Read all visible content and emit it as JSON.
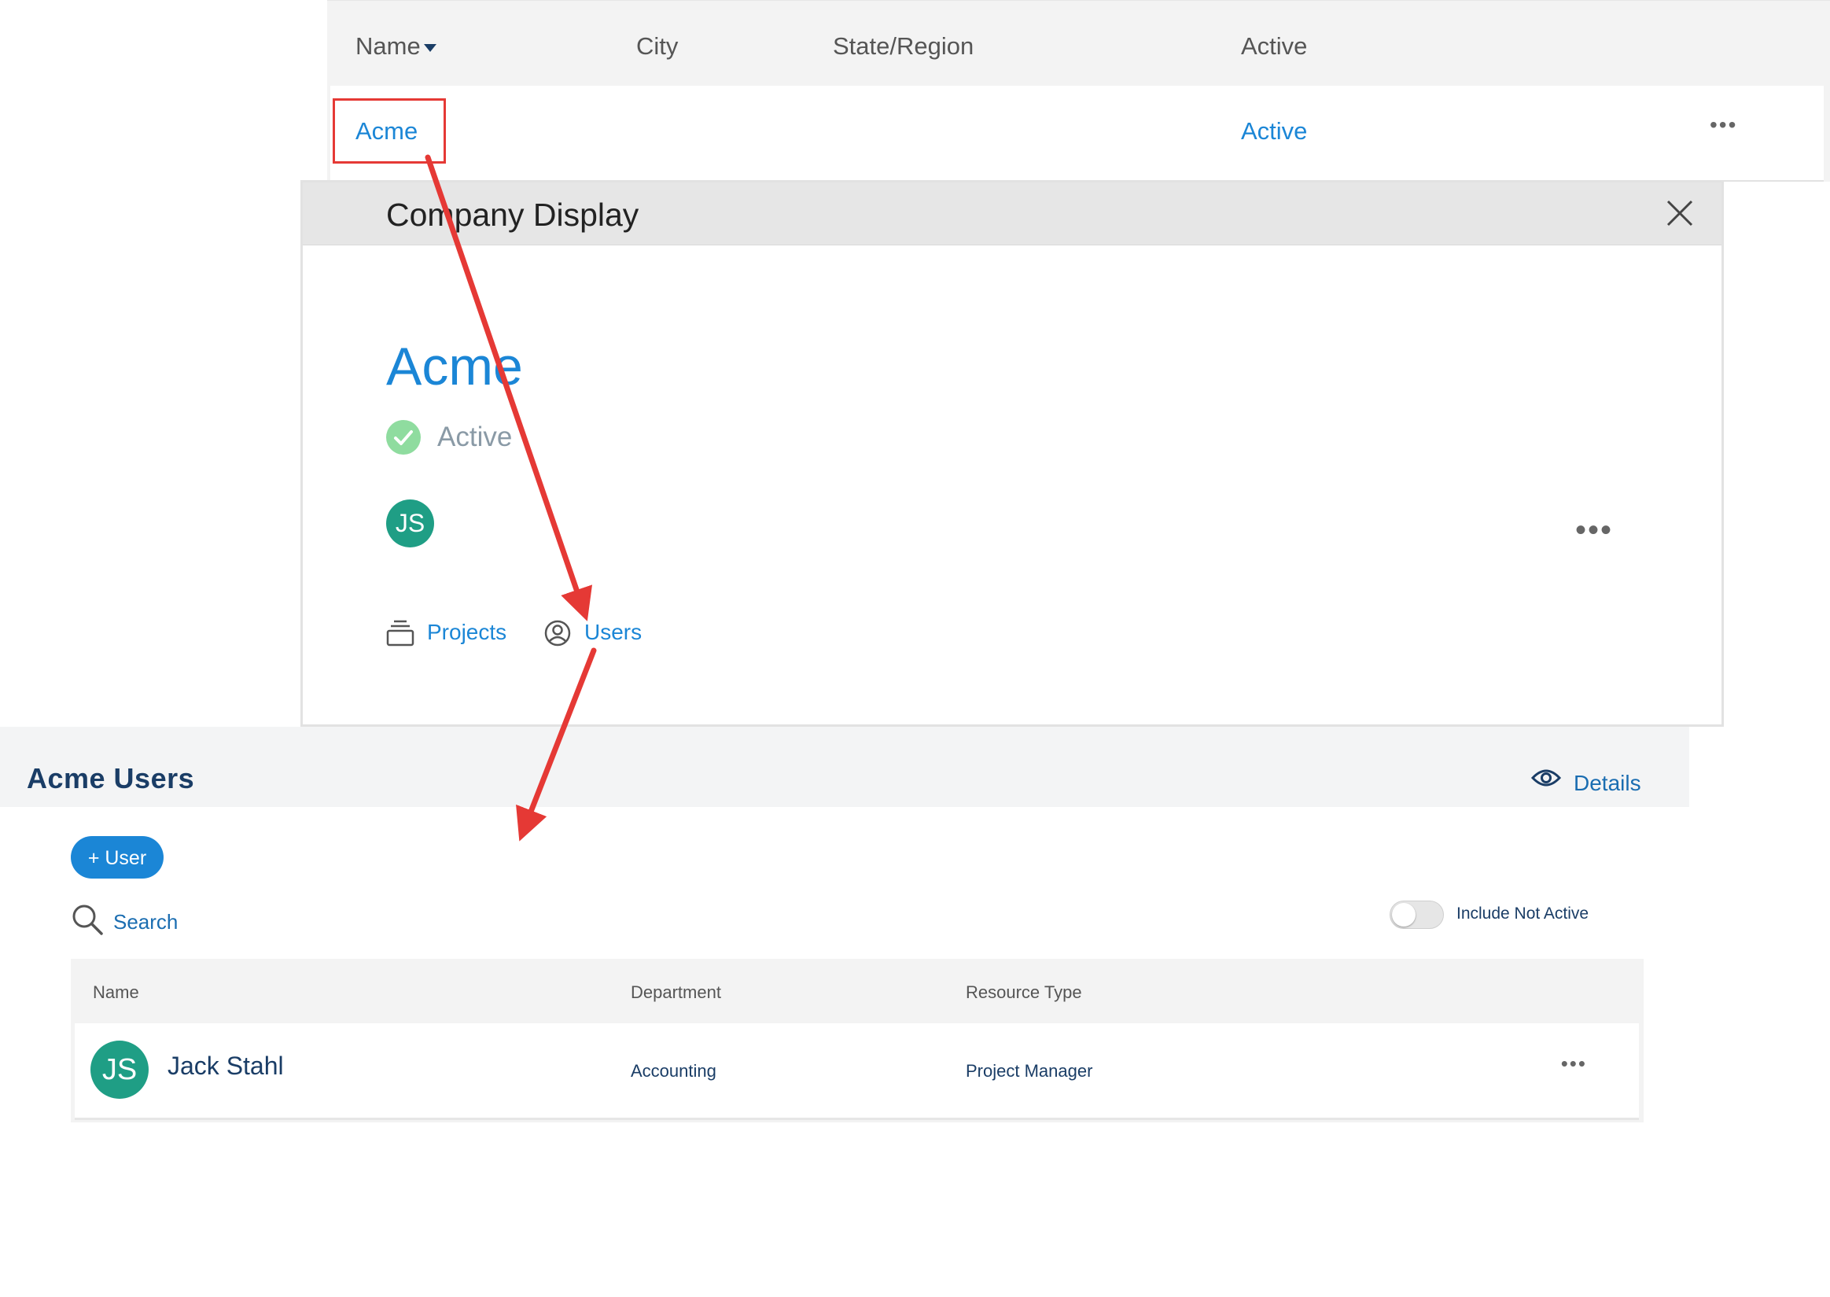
{
  "companies_table": {
    "columns": [
      "Name",
      "City",
      "State/Region",
      "Active"
    ],
    "rows": [
      {
        "name": "Acme",
        "city": "",
        "state": "",
        "active": "Active",
        "menu": "•••"
      }
    ]
  },
  "company_display": {
    "title": "Company Display",
    "company_name": "Acme",
    "status": "Active",
    "avatar_initials": "JS",
    "menu": "•••",
    "links": {
      "projects": "Projects",
      "users": "Users"
    }
  },
  "users_panel": {
    "title": "Acme Users",
    "details_label": "Details",
    "add_button": "+ User",
    "search_placeholder": "Search",
    "toggle_label": "Include Not Active",
    "toggle_on": false,
    "columns": [
      "Name",
      "Department",
      "Resource Type"
    ],
    "rows": [
      {
        "initials": "JS",
        "name": "Jack Stahl",
        "department": "Accounting",
        "resource_type": "Project Manager",
        "menu": "•••"
      }
    ]
  },
  "colors": {
    "link": "#1b86d6",
    "avatar": "#1f9e85",
    "status_ok": "#8fdc9f",
    "annotation": "#e53935",
    "heading": "#1a3d66"
  }
}
